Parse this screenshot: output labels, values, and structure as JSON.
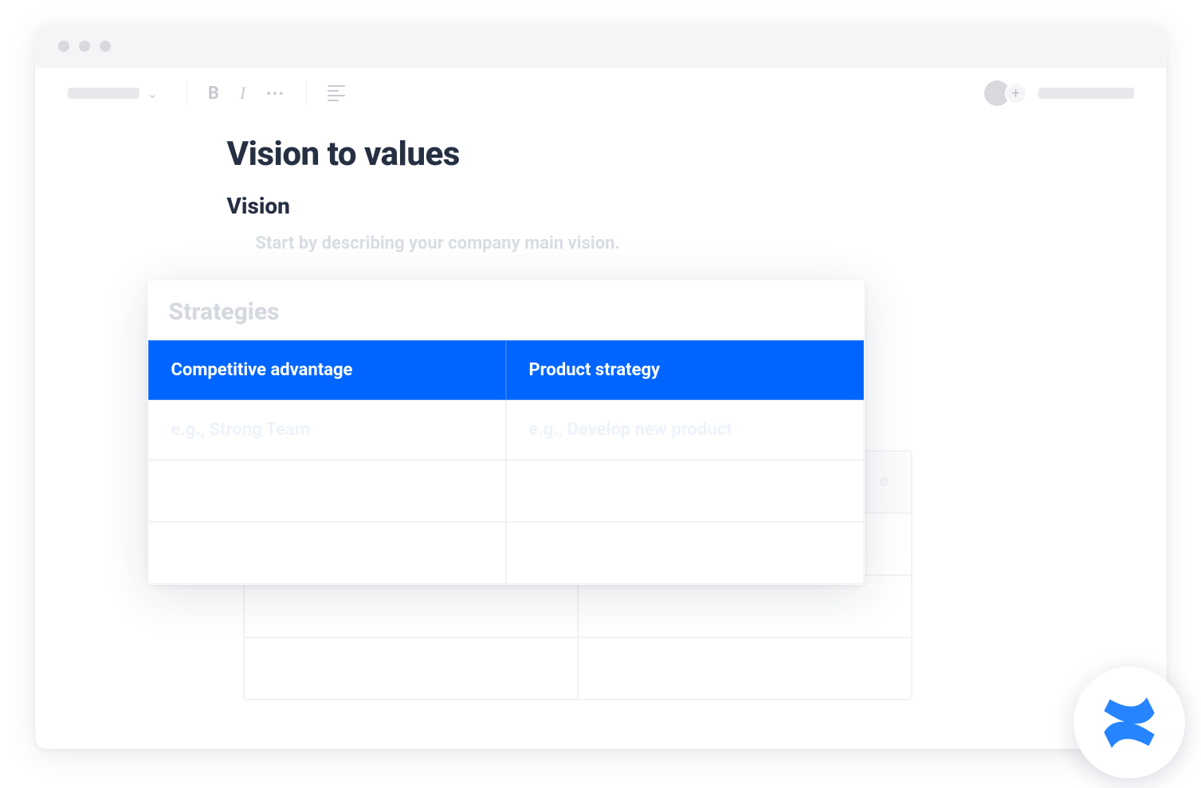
{
  "toolbar": {
    "bold_label": "B",
    "italic_label": "I",
    "more_label": "•••",
    "add_user_label": "+"
  },
  "doc": {
    "title": "Vision to values",
    "section_vision": "Vision",
    "vision_hint": "Start by describing your company main vision."
  },
  "bg_table": {
    "col2_trail": "e"
  },
  "strategies": {
    "title": "Strategies",
    "headers": [
      "Competitive advantage",
      "Product strategy"
    ],
    "row1": [
      "e.g., Strong Team",
      "e.g., Develop new product"
    ]
  },
  "colors": {
    "accent": "#0065ff",
    "text_dark": "#263042",
    "placeholder_faint": "#d5d9df"
  },
  "brand": {
    "name": "Confluence"
  }
}
